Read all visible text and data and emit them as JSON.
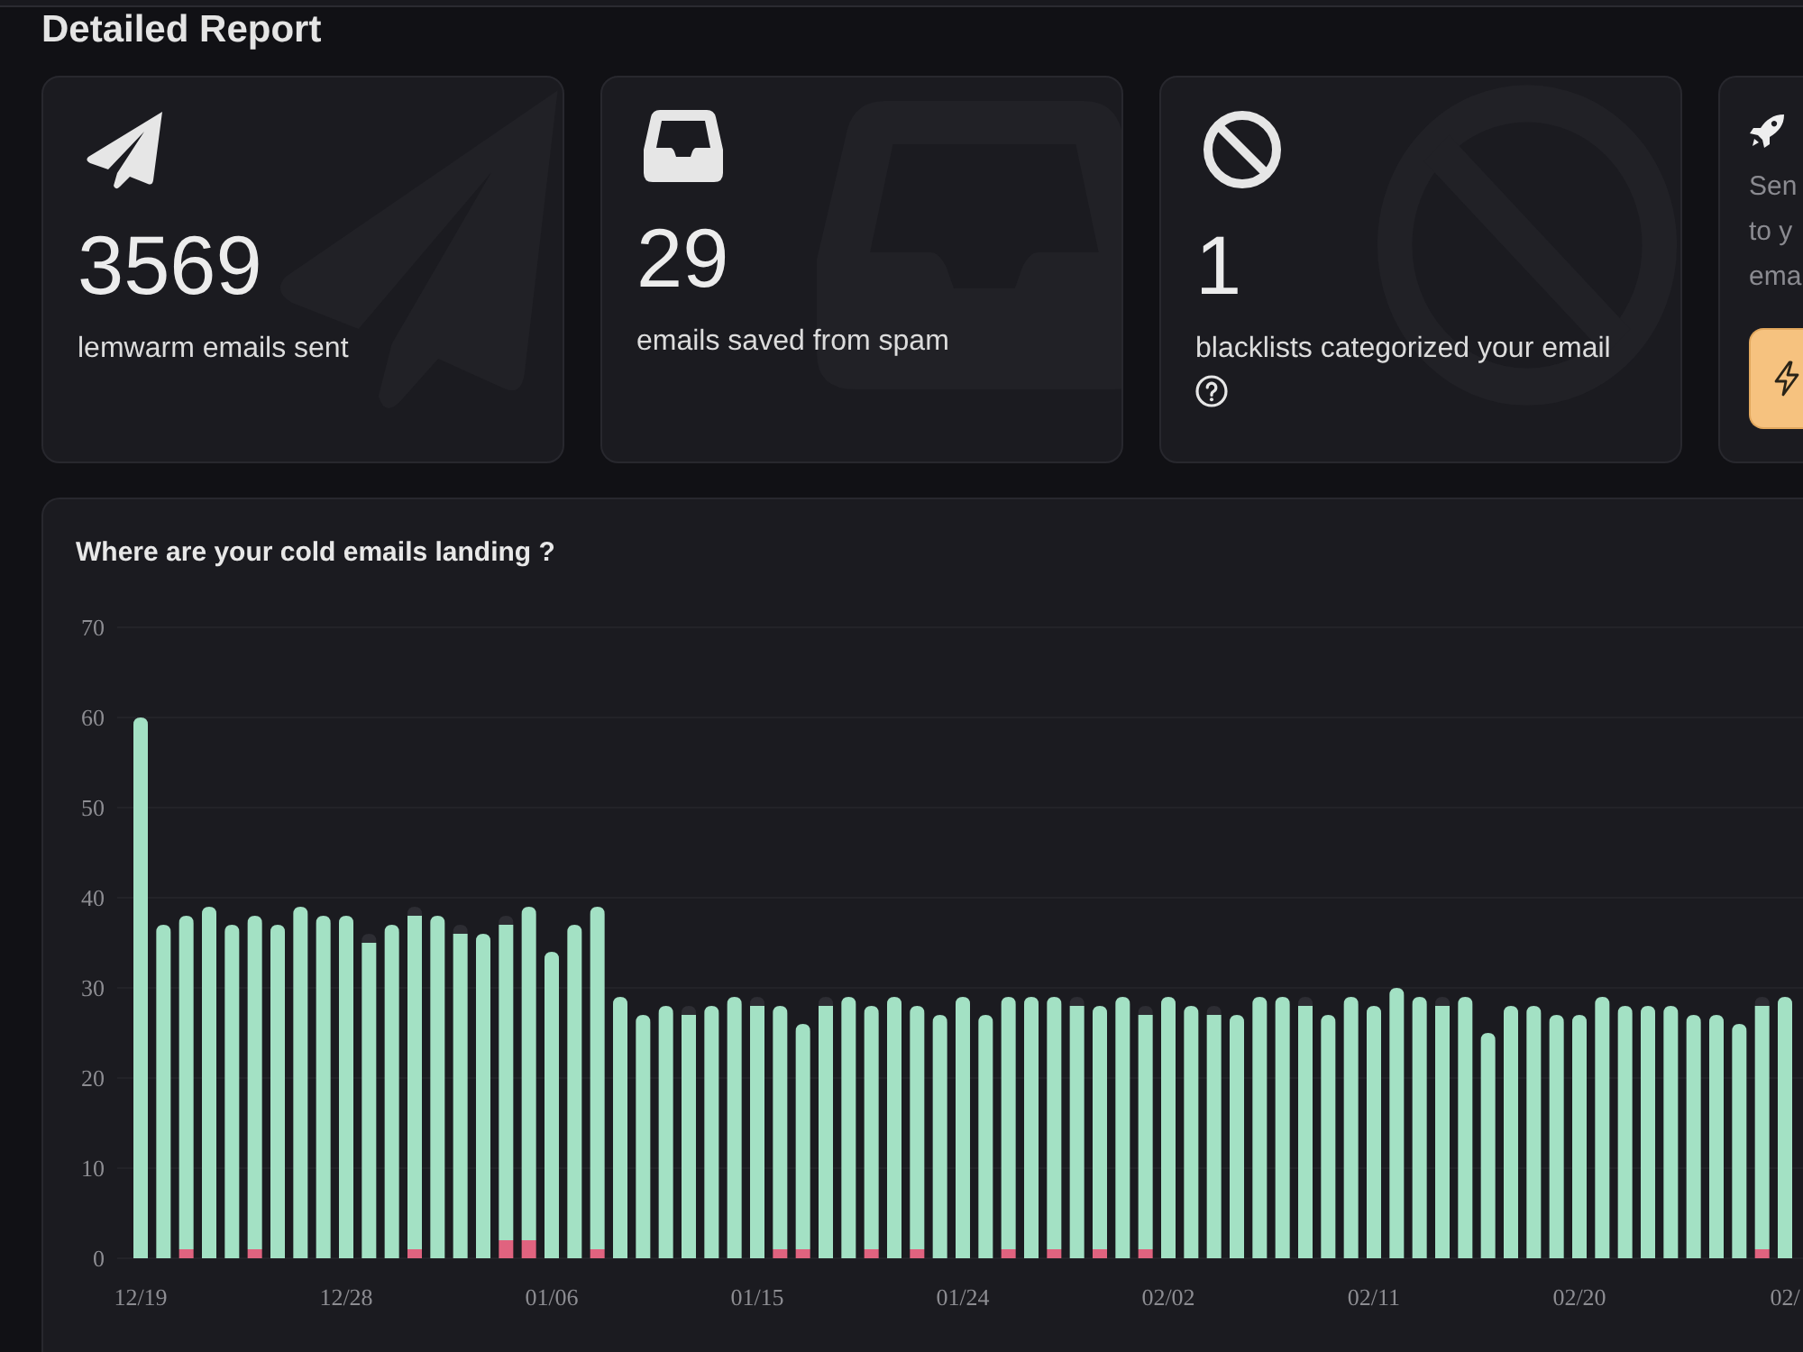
{
  "page": {
    "title": "Detailed Report"
  },
  "stats": [
    {
      "kind": "sent",
      "value": "3569",
      "label": "lemwarm emails sent",
      "help": false
    },
    {
      "kind": "saved",
      "value": "29",
      "label": "emails saved from spam",
      "help": false
    },
    {
      "kind": "blocked",
      "value": "1",
      "label": "blacklists categorized your email",
      "help": true
    }
  ],
  "promo": {
    "description_lines": [
      "Sen",
      "to y",
      "ema"
    ]
  },
  "landing_chart": {
    "title": "Where are your cold emails landing ?",
    "chart_data": {
      "type": "bar",
      "stacked": true,
      "grid": true,
      "ylim": [
        0,
        70
      ],
      "yticks": [
        0,
        10,
        20,
        30,
        40,
        50,
        60,
        70
      ],
      "categories": [
        "12/19",
        null,
        null,
        null,
        null,
        null,
        null,
        null,
        null,
        "12/28",
        null,
        null,
        null,
        null,
        null,
        null,
        null,
        null,
        "01/06",
        null,
        null,
        null,
        null,
        null,
        null,
        null,
        null,
        "01/15",
        null,
        null,
        null,
        null,
        null,
        null,
        null,
        null,
        "01/24",
        null,
        null,
        null,
        null,
        null,
        null,
        null,
        null,
        "02/02",
        null,
        null,
        null,
        null,
        null,
        null,
        null,
        null,
        "02/11",
        null,
        null,
        null,
        null,
        null,
        null,
        null,
        null,
        "02/20",
        null,
        null,
        null,
        null,
        null,
        null,
        null,
        null,
        "02/"
      ],
      "series": [
        {
          "color": "#e0637f",
          "values": [
            0,
            0,
            1,
            0,
            0,
            1,
            0,
            0,
            0,
            0,
            0,
            0,
            1,
            0,
            0,
            0,
            2,
            2,
            0,
            0,
            1,
            0,
            0,
            0,
            0,
            0,
            0,
            0,
            1,
            1,
            0,
            0,
            1,
            0,
            1,
            0,
            0,
            0,
            1,
            0,
            1,
            0,
            1,
            0,
            1,
            0,
            0,
            0,
            0,
            0,
            0,
            0,
            0,
            0,
            0,
            0,
            0,
            0,
            0,
            0,
            0,
            0,
            0,
            0,
            0,
            0,
            0,
            0,
            0,
            0,
            0,
            1,
            0
          ]
        },
        {
          "color": "#a3e1c4",
          "values": [
            60,
            37,
            37,
            39,
            37,
            37,
            37,
            39,
            38,
            38,
            35,
            37,
            37,
            38,
            36,
            36,
            35,
            37,
            34,
            37,
            38,
            29,
            27,
            28,
            27,
            28,
            29,
            28,
            27,
            25,
            28,
            29,
            27,
            29,
            27,
            27,
            29,
            27,
            28,
            29,
            28,
            28,
            27,
            29,
            26,
            29,
            28,
            27,
            27,
            29,
            29,
            28,
            27,
            29,
            28,
            30,
            29,
            28,
            29,
            25,
            28,
            28,
            27,
            27,
            29,
            28,
            28,
            28,
            27,
            27,
            26,
            27,
            29
          ]
        },
        {
          "color": "#2d2d33",
          "values": [
            0,
            0,
            0,
            0,
            0,
            0,
            0,
            0,
            0,
            0,
            1,
            0,
            1,
            0,
            1,
            0,
            1,
            0,
            0,
            0,
            0,
            0,
            0,
            0,
            1,
            0,
            0,
            1,
            0,
            0,
            1,
            0,
            0,
            0,
            0,
            0,
            0,
            0,
            0,
            0,
            0,
            1,
            0,
            0,
            1,
            0,
            0,
            1,
            0,
            0,
            0,
            1,
            0,
            0,
            0,
            0,
            0,
            1,
            0,
            0,
            0,
            0,
            0,
            0,
            0,
            0,
            0,
            0,
            0,
            0,
            0,
            1,
            0
          ]
        }
      ]
    }
  }
}
